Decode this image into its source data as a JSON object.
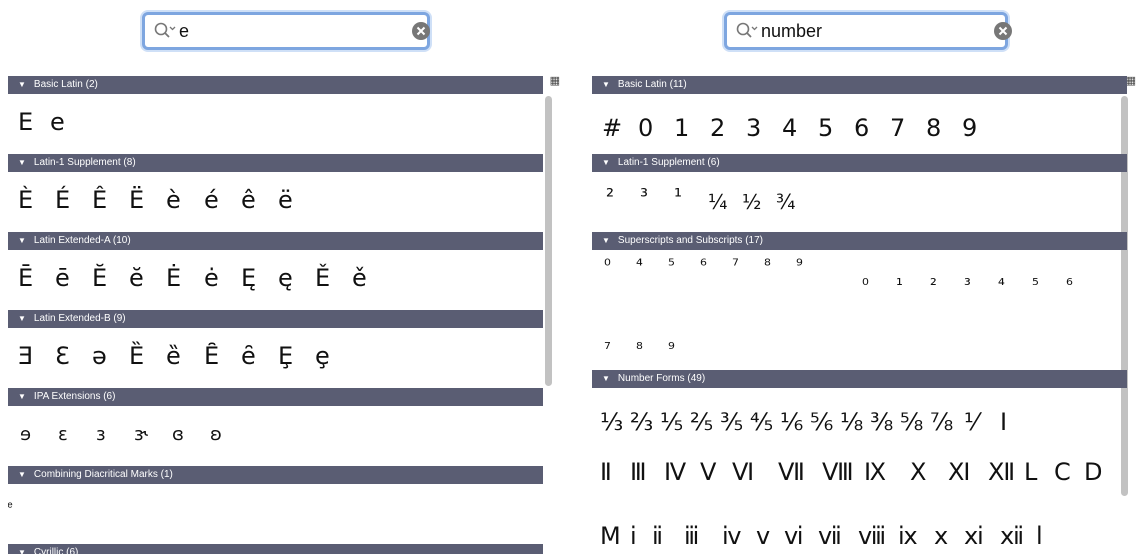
{
  "left": {
    "search": {
      "value": "e"
    },
    "sections": [
      {
        "title": "Basic Latin (2)",
        "glyphs": [
          "E",
          "e"
        ]
      },
      {
        "title": "Latin-1 Supplement (8)",
        "glyphs": [
          "È",
          "É",
          "Ê",
          "Ë",
          "è",
          "é",
          "ê",
          "ë"
        ]
      },
      {
        "title": "Latin Extended-A (10)",
        "glyphs": [
          "Ē",
          "ē",
          "Ĕ",
          "ĕ",
          "Ė",
          "ė",
          "Ę",
          "ę",
          "Ě",
          "ě"
        ]
      },
      {
        "title": "Latin Extended-B (9)",
        "glyphs": [
          "Ǝ",
          "Ɛ",
          "ə",
          "Ȅ",
          "ȅ",
          "Ȇ",
          "ȇ",
          "Ȩ",
          "ȩ"
        ]
      },
      {
        "title": "IPA Extensions (6)",
        "glyphs": [
          "ɘ",
          "ɛ",
          "ɜ",
          "ɝ",
          "ɞ",
          "ʚ"
        ]
      },
      {
        "title": "Combining Diacritical Marks (1)",
        "glyphs": [
          "ͤ"
        ]
      },
      {
        "title": "Cyrillic (6)",
        "glyphs": []
      }
    ]
  },
  "right": {
    "search": {
      "value": "number"
    },
    "sections": [
      {
        "title": "Basic Latin (11)",
        "glyphs": [
          "#",
          "0",
          "1",
          "2",
          "3",
          "4",
          "5",
          "6",
          "7",
          "8",
          "9"
        ]
      },
      {
        "title": "Latin-1 Supplement (6)",
        "glyphs": [
          "²",
          "³",
          "¹",
          "¼",
          "½",
          "¾"
        ]
      },
      {
        "title": "Superscripts and Subscripts (17)",
        "glyphs": [
          "⁰",
          "⁴",
          "⁵",
          "⁶",
          "⁷",
          "⁸",
          "⁹",
          "₀",
          "₁",
          "₂",
          "₃",
          "₄",
          "₅",
          "₆",
          "₇",
          "₈",
          "₉"
        ]
      },
      {
        "title": "Number Forms (49)",
        "glyphs": [
          "⅓",
          "⅔",
          "⅕",
          "⅖",
          "⅗",
          "⅘",
          "⅙",
          "⅚",
          "⅛",
          "⅜",
          "⅝",
          "⅞",
          "⅟",
          "Ⅰ",
          "Ⅱ",
          "Ⅲ",
          "Ⅳ",
          "Ⅴ",
          "Ⅵ",
          "Ⅶ",
          "Ⅷ",
          "Ⅸ",
          "Ⅹ",
          "Ⅺ",
          "Ⅻ",
          "Ⅼ",
          "Ⅽ",
          "Ⅾ",
          "Ⅿ",
          "ⅰ",
          "ⅱ",
          "ⅲ",
          "ⅳ",
          "ⅴ",
          "ⅵ",
          "ⅶ",
          "ⅷ",
          "ⅸ",
          "ⅹ",
          "ⅺ",
          "ⅻ",
          "ⅼ"
        ]
      }
    ]
  },
  "icons": {
    "search": "magnifier-icon",
    "clear": "clear-circle-x-icon",
    "disclosure": "triangle-down-icon",
    "corner": "character-grid-icon"
  }
}
